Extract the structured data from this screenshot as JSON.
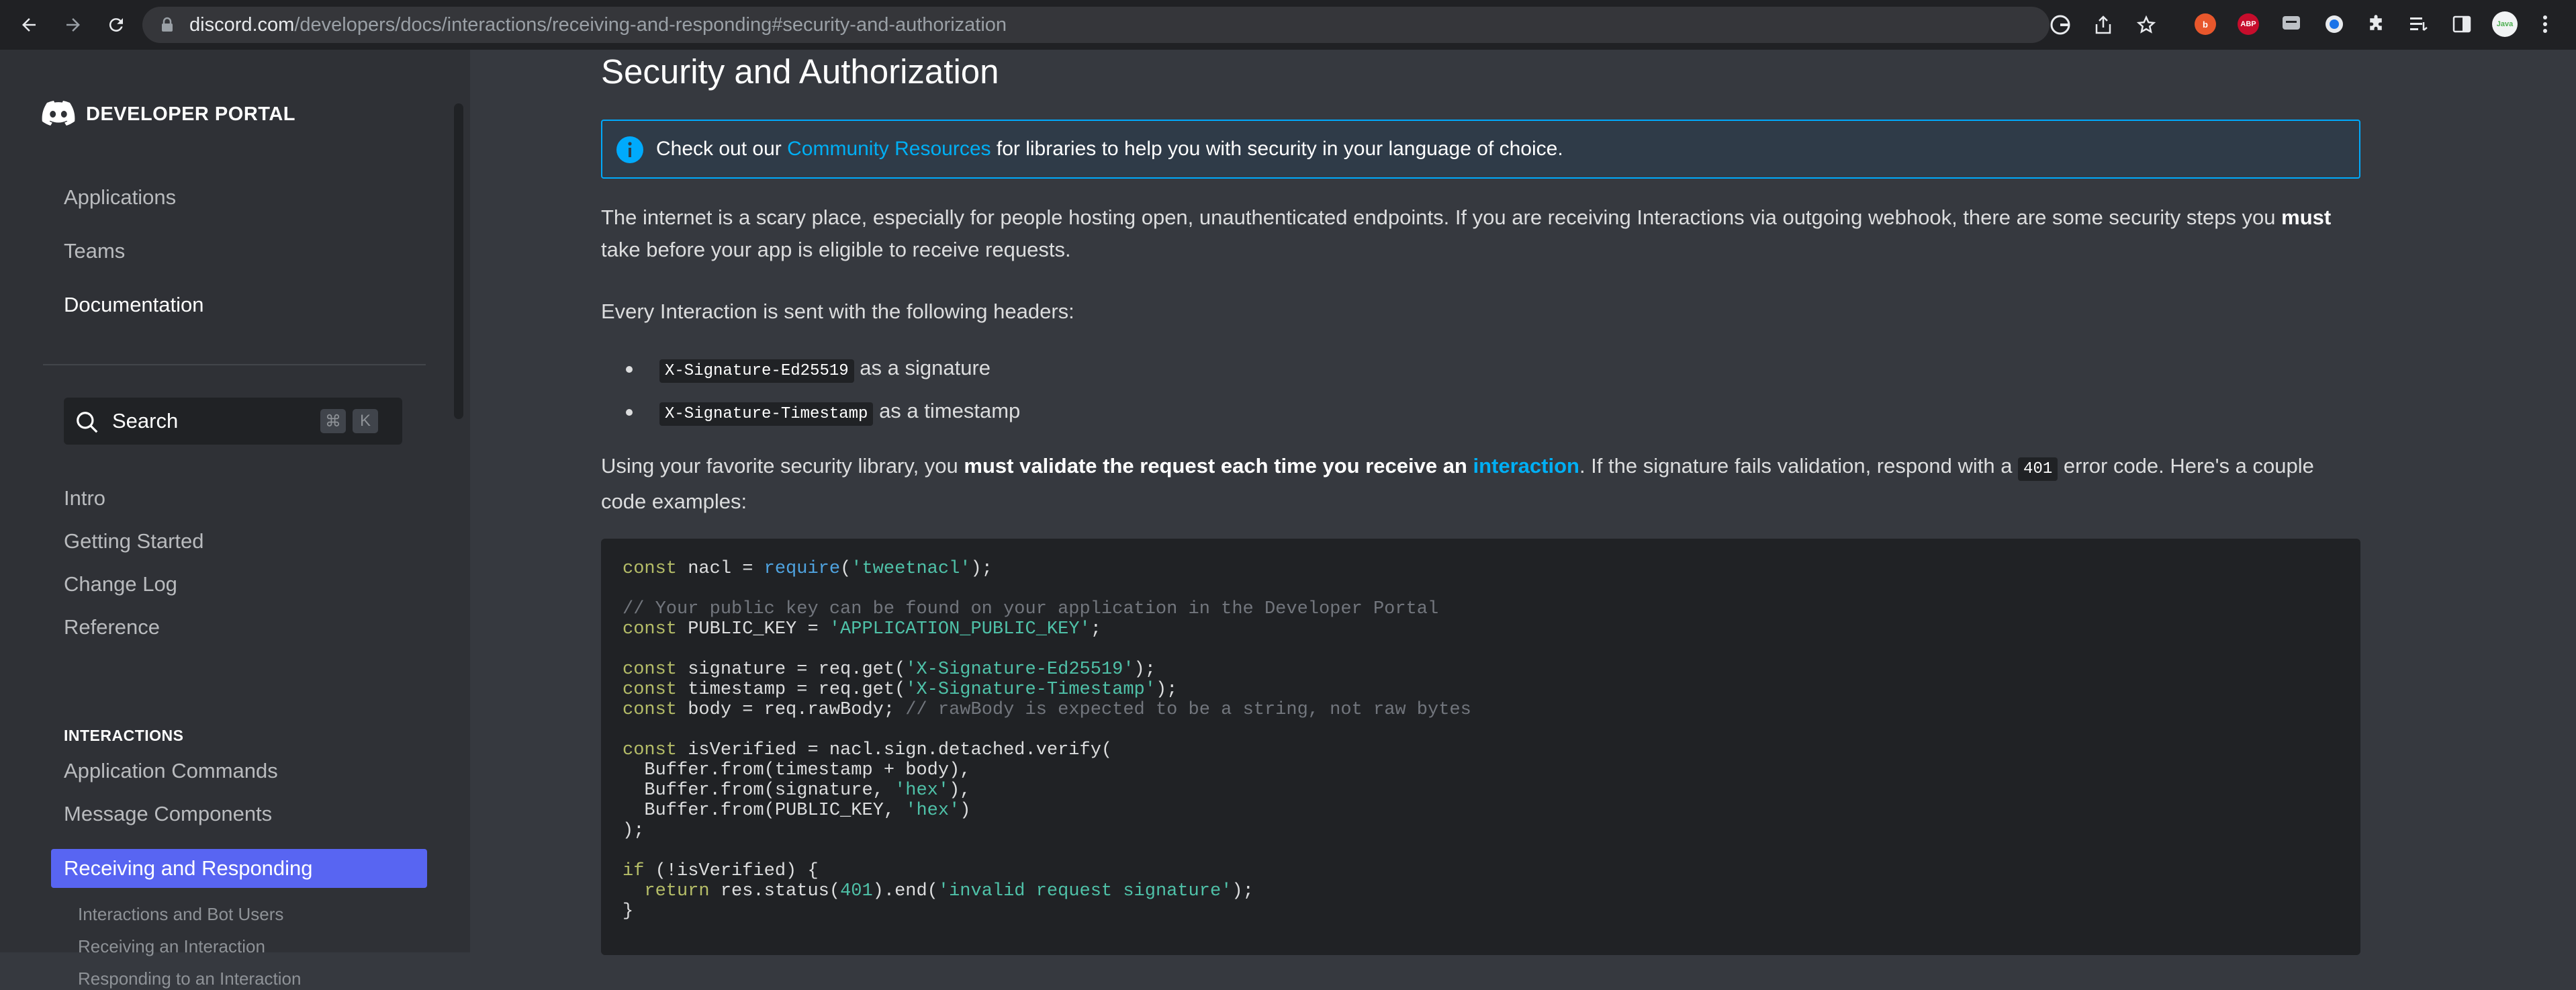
{
  "browser": {
    "url_host": "discord.com",
    "url_path": "/developers/docs/interactions/receiving-and-responding#security-and-authorization",
    "icons": [
      "back-icon",
      "forward-icon",
      "reload-icon",
      "lock-icon",
      "google-icon",
      "share-icon",
      "star-icon",
      "extension-icon",
      "abp-icon",
      "puzzle-icon",
      "reading-list-icon",
      "side-panel-icon",
      "profile-avatar",
      "menu-icon"
    ],
    "abp_label": "ABP",
    "profile_label": "Java"
  },
  "sidebar": {
    "portal_title": "DEVELOPER PORTAL",
    "top_links": [
      "Applications",
      "Teams",
      "Documentation"
    ],
    "search": {
      "label": "Search",
      "shortcut_mod": "⌘",
      "shortcut_key": "K"
    },
    "items": [
      "Intro",
      "Getting Started",
      "Change Log",
      "Reference"
    ],
    "section": "INTERACTIONS",
    "section_items": [
      "Application Commands",
      "Message Components",
      "Receiving and Responding"
    ],
    "sub_items": [
      "Interactions and Bot Users",
      "Receiving an Interaction",
      "Responding to an Interaction"
    ]
  },
  "content": {
    "title": "Security and Authorization",
    "info": {
      "before": "Check out our ",
      "link": "Community Resources",
      "after": " for libraries to help you with security in your language of choice."
    },
    "p1": {
      "text": "The internet is a scary place, especially for people hosting open, unauthenticated endpoints. If you are receiving Interactions via outgoing webhook, there are some security steps you ",
      "bold": "must",
      "text2": " take before your app is eligible to receive requests."
    },
    "p2": "Every Interaction is sent with the following headers:",
    "bullets": [
      {
        "code": "X-Signature-Ed25519",
        "text": " as a signature"
      },
      {
        "code": "X-Signature-Timestamp",
        "text": " as a timestamp"
      }
    ],
    "p3": {
      "text": "Using your favorite security library, you ",
      "bold": "must validate the request each time you receive an ",
      "link": "interaction",
      "text2": ". If the signature fails validation, respond with a ",
      "code": "401",
      "text3": " error code. Here's a couple code examples:"
    },
    "code_lines": [
      "const nacl = require('tweetnacl');",
      "// Your public key can be found on your application in the Developer Portal",
      "const PUBLIC_KEY = 'APPLICATION_PUBLIC_KEY';",
      "const signature = req.get('X-Signature-Ed25519');",
      "const timestamp = req.get('X-Signature-Timestamp');",
      "const body = req.rawBody; // rawBody is expected to be a string, not raw bytes",
      "const isVerified = nacl.sign.detached.verify(",
      "  Buffer.from(timestamp + body),",
      "  Buffer.from(signature, 'hex'),",
      "  Buffer.from(PUBLIC_KEY, 'hex')",
      ");",
      "if (!isVerified) {",
      "  return res.status(401).end('invalid request signature');",
      "}"
    ]
  },
  "colors": {
    "accent": "#5865f2",
    "link": "#00aff4",
    "info_border": "#00aafc"
  }
}
